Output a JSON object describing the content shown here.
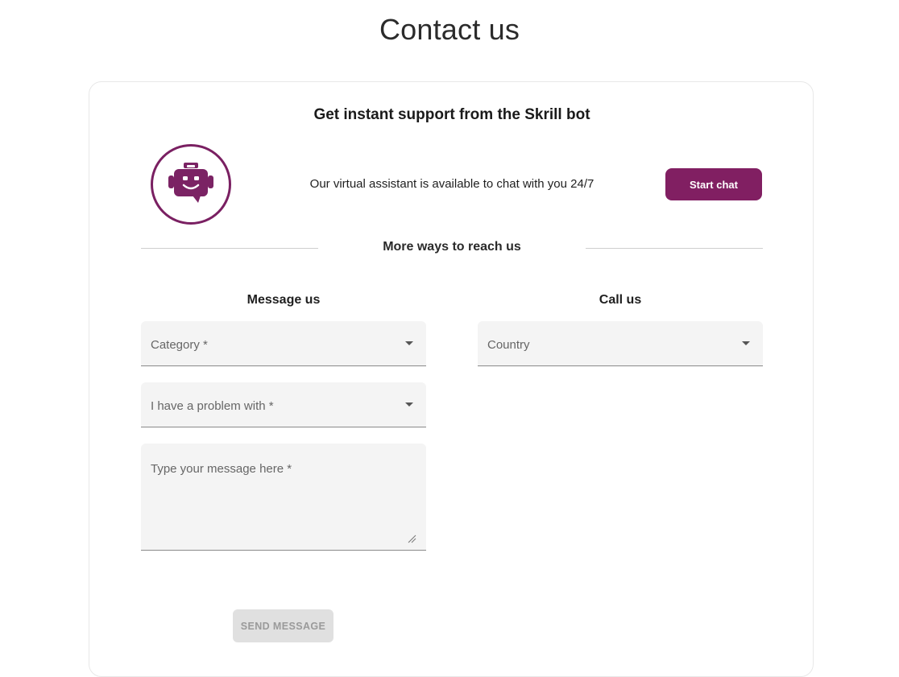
{
  "page": {
    "title": "Contact us"
  },
  "bot": {
    "heading": "Get instant support from the Skrill bot",
    "description": "Our virtual assistant is available to chat with you 24/7",
    "button_label": "Start chat",
    "icon": "chat-bot-icon"
  },
  "more_ways": {
    "heading": "More ways to reach us"
  },
  "message_us": {
    "heading": "Message us",
    "category_label": "Category *",
    "problem_label": "I have a problem with *",
    "message_placeholder": "Type your message here *",
    "send_label": "SEND MESSAGE"
  },
  "call_us": {
    "heading": "Call us",
    "country_label": "Country"
  },
  "colors": {
    "brand": "#811f62",
    "field_bg": "#f4f4f4",
    "disabled_button": "#e0e0e0"
  }
}
